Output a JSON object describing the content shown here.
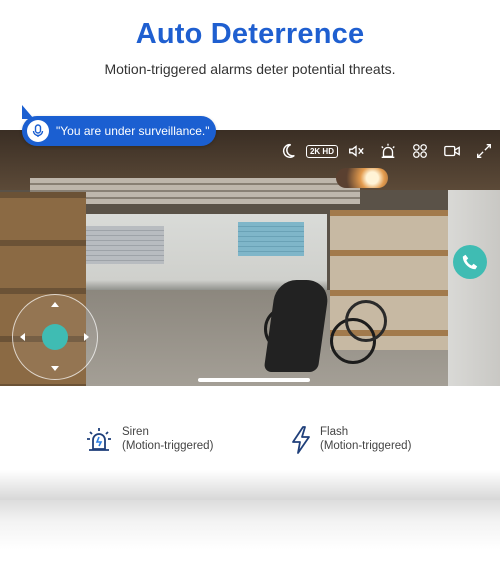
{
  "header": {
    "title": "Auto Deterrence",
    "subtitle": "Motion-triggered alarms deter potential threats."
  },
  "bubble": {
    "text": "\"You are under surveillance.\"",
    "icon": "microphone-icon"
  },
  "toolbar": {
    "hd_label": "2K HD",
    "icons": [
      "night-mode-icon",
      "2k-hd-badge",
      "mute-icon",
      "siren-icon",
      "flash-icon",
      "record-icon",
      "fullscreen-icon"
    ]
  },
  "features": [
    {
      "icon": "siren-icon",
      "label": "Siren",
      "detail": "(Motion-triggered)"
    },
    {
      "icon": "flash-icon",
      "label": "Flash",
      "detail": "(Motion-triggered)"
    }
  ],
  "colors": {
    "brand_blue": "#1f5fd0",
    "teal": "#3fbcb3"
  }
}
